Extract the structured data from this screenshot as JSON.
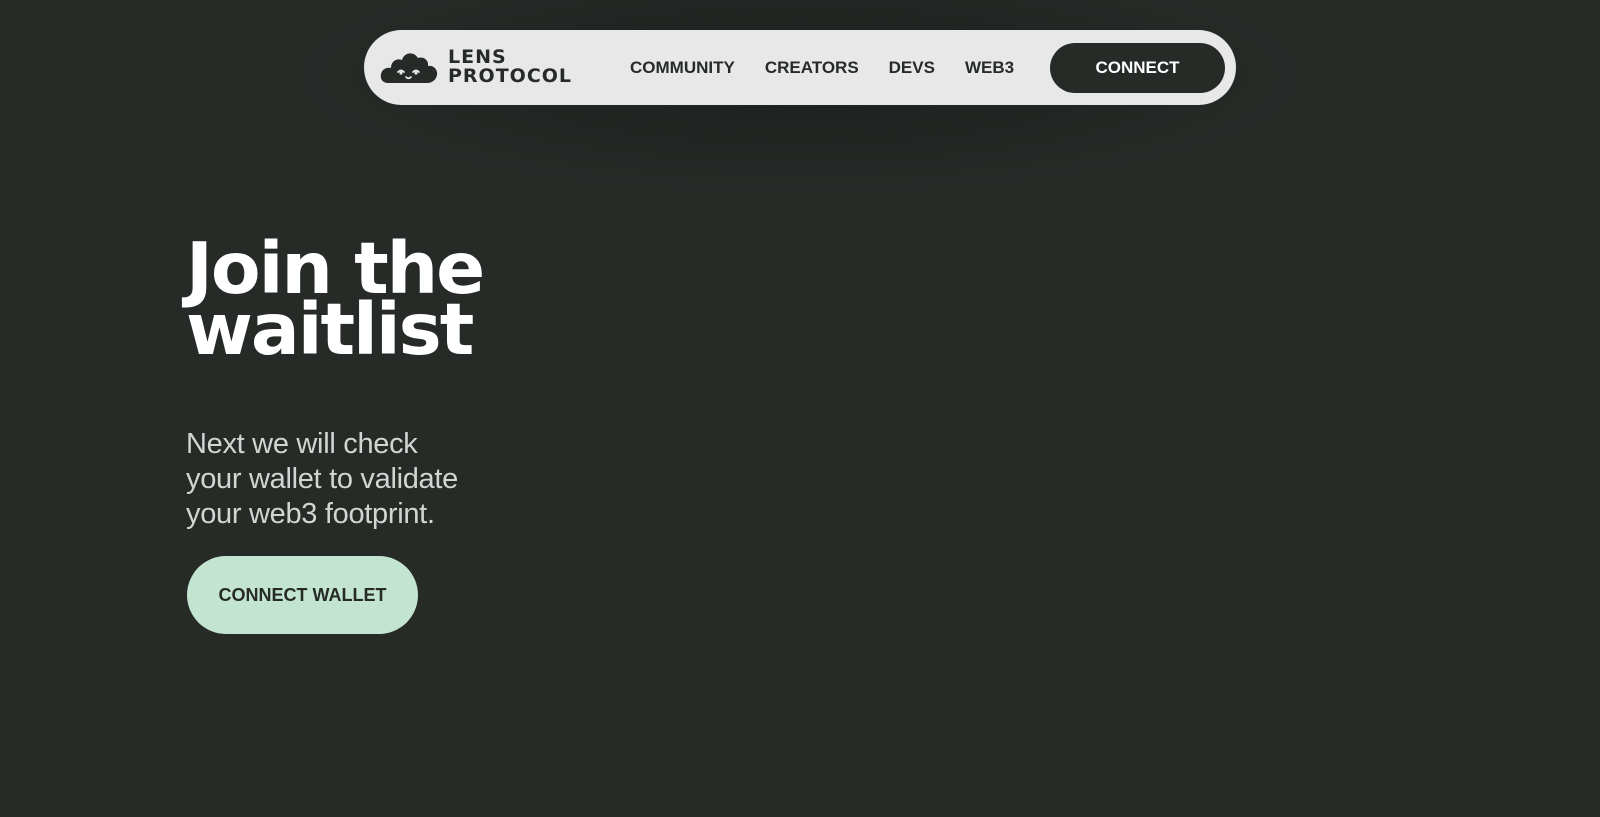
{
  "header": {
    "logo": {
      "line1": "LENS",
      "line2": "PROTOCOL",
      "icon": "lens-cloud-face-icon"
    },
    "nav": [
      {
        "label": "COMMUNITY"
      },
      {
        "label": "CREATORS"
      },
      {
        "label": "DEVS"
      },
      {
        "label": "WEB3"
      }
    ],
    "connect_label": "CONNECT"
  },
  "hero": {
    "title_line1": "Join the",
    "title_line2": "waitlist",
    "subtitle_line1": "Next we will check",
    "subtitle_line2": "your wallet to validate",
    "subtitle_line3": "your web3 footprint.",
    "cta_label": "CONNECT WALLET"
  },
  "colors": {
    "background": "#262b28",
    "navbar": "#e8e8e8",
    "button_dark": "#262b28",
    "accent_mint": "#c3e4d0",
    "text_light": "#ffffff",
    "text_muted": "#d2d6d3"
  }
}
